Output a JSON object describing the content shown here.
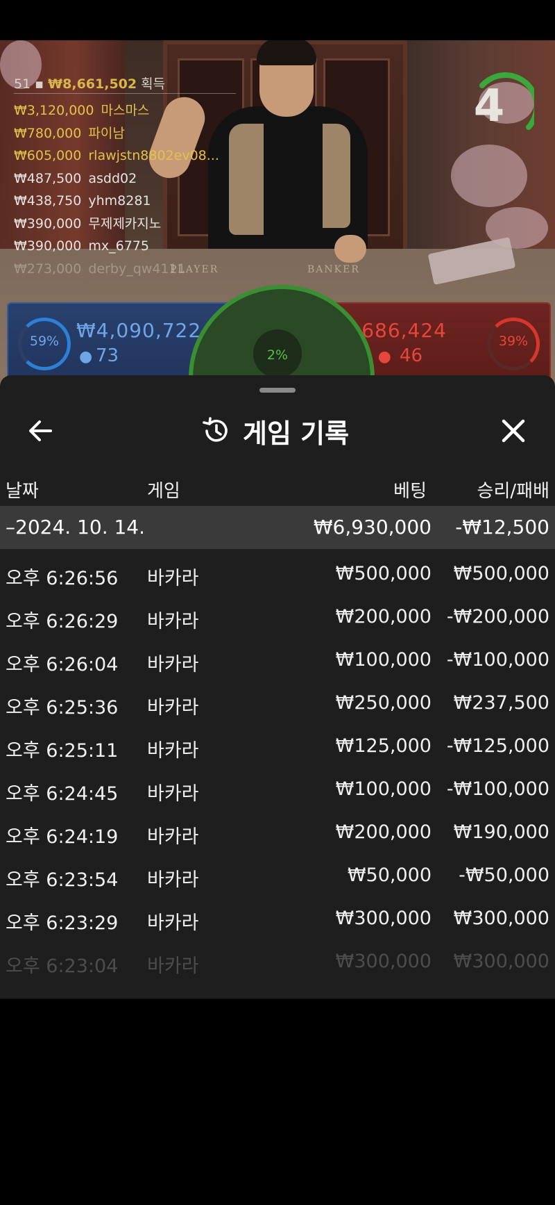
{
  "video": {
    "table_player": "PLAYER",
    "table_banker": "BANKER",
    "timer": "4",
    "winners_header": {
      "count": "51",
      "amount": "₩8,661,502",
      "suffix": "획득"
    },
    "winners": [
      {
        "amount": "₩3,120,000",
        "name": "마스마스"
      },
      {
        "amount": "₩780,000",
        "name": "파이남"
      },
      {
        "amount": "₩605,000",
        "name": "rlawjstn8802ev08..."
      },
      {
        "amount": "₩487,500",
        "name": "asdd02"
      },
      {
        "amount": "₩438,750",
        "name": "yhm8281"
      },
      {
        "amount": "₩390,000",
        "name": "무제제카지노"
      },
      {
        "amount": "₩390,000",
        "name": "mx_6775"
      },
      {
        "amount": "₩273,000",
        "name": "derby_qw4111"
      }
    ],
    "player": {
      "percent": "59%",
      "amount": "₩4,090,722",
      "count": "73"
    },
    "banker": {
      "percent": "39%",
      "amount": "₩2,686,424",
      "count": "46"
    },
    "tie": {
      "percent": "2%"
    }
  },
  "history": {
    "title": "게임 기록",
    "columns": {
      "date": "날짜",
      "game": "게임",
      "bet": "베팅",
      "result": "승리/패배"
    },
    "group": {
      "date": "–2024. 10. 14.",
      "bet": "₩6,930,000",
      "result": "-₩12,500"
    },
    "rows": [
      {
        "time": "오후 6:26:56",
        "game": "바카라",
        "bet": "₩500,000",
        "result": "₩500,000"
      },
      {
        "time": "오후 6:26:29",
        "game": "바카라",
        "bet": "₩200,000",
        "result": "-₩200,000"
      },
      {
        "time": "오후 6:26:04",
        "game": "바카라",
        "bet": "₩100,000",
        "result": "-₩100,000"
      },
      {
        "time": "오후 6:25:36",
        "game": "바카라",
        "bet": "₩250,000",
        "result": "₩237,500"
      },
      {
        "time": "오후 6:25:11",
        "game": "바카라",
        "bet": "₩125,000",
        "result": "-₩125,000"
      },
      {
        "time": "오후 6:24:45",
        "game": "바카라",
        "bet": "₩100,000",
        "result": "-₩100,000"
      },
      {
        "time": "오후 6:24:19",
        "game": "바카라",
        "bet": "₩200,000",
        "result": "₩190,000"
      },
      {
        "time": "오후 6:23:54",
        "game": "바카라",
        "bet": "₩50,000",
        "result": "-₩50,000"
      },
      {
        "time": "오후 6:23:29",
        "game": "바카라",
        "bet": "₩300,000",
        "result": "₩300,000"
      },
      {
        "time": "오후 6:23:04",
        "game": "바카라",
        "bet": "₩300,000",
        "result": "₩300,000"
      }
    ]
  },
  "colors": {
    "player_ring": "#2f7fd6",
    "banker_ring": "#d6362c",
    "tie_ring": "#3b8f33",
    "timer_ring": "#3aa83a"
  },
  "icons": {
    "back": "arrow-left-icon",
    "history": "history-clock-icon",
    "close": "close-icon",
    "person": "person-icon"
  }
}
